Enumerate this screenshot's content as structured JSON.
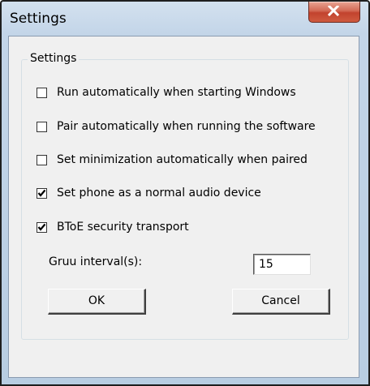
{
  "window": {
    "title": "Settings"
  },
  "group": {
    "legend": "Settings"
  },
  "options": [
    {
      "label": "Run automatically when starting Windows",
      "checked": false
    },
    {
      "label": "Pair automatically when running the software",
      "checked": false
    },
    {
      "label": "Set minimization automatically when paired",
      "checked": false
    },
    {
      "label": "Set phone as a normal audio device",
      "checked": true
    },
    {
      "label": "BToE security transport",
      "checked": true
    }
  ],
  "gruu": {
    "label": "Gruu interval(s):",
    "value": "15"
  },
  "buttons": {
    "ok": "OK",
    "cancel": "Cancel"
  },
  "icons": {
    "close": "close-icon",
    "check": "checkmark-icon"
  },
  "colors": {
    "close_button": "#c7442f",
    "dialog_background": "#f0f0f0",
    "titlebar": "#c3d5e8"
  }
}
